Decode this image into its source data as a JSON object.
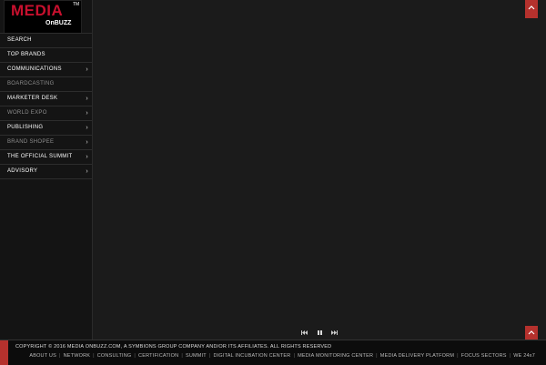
{
  "logo": {
    "line1": "MEDIA",
    "line2": "OnBUZZ",
    "tm": "TM"
  },
  "sidebar": {
    "items": [
      {
        "label": "SEARCH",
        "submenu": false
      },
      {
        "label": "TOP BRANDS",
        "submenu": false
      },
      {
        "label": "COMMUNICATIONS",
        "submenu": true
      },
      {
        "label": "BOARDCASTING",
        "submenu": false
      },
      {
        "label": "MARKETER DESK",
        "submenu": true
      },
      {
        "label": "WORLD EXPO",
        "submenu": true
      },
      {
        "label": "PUBLISHING",
        "submenu": true
      },
      {
        "label": "BRAND SHOPEE",
        "submenu": true
      },
      {
        "label": "THE OFFICIAL SUMMIT",
        "submenu": true
      },
      {
        "label": "ADVISORY",
        "submenu": true
      }
    ],
    "chevron": "›"
  },
  "footer": {
    "copyright": "COPYRIGHT © 2016 MEDIA ONBUZZ.COM, A SYMBIONS GROUP COMPANY AND/OR ITS AFFILIATES. ALL RIGHTS RESERVED",
    "links": [
      "ABOUT US",
      "NETWORK",
      "CONSULTING",
      "CERTIFICATION",
      "SUMMIT",
      "DIGITAL INCUBATION CENTER",
      "MEDIA MONITORING CENTER",
      "MEDIA DELIVERY PLATFORM",
      "FOCUS SECTORS",
      "WE 24x7"
    ]
  },
  "colors": {
    "accent": "#b5312d",
    "brand_red": "#c8102e",
    "background": "#1b1b1b"
  },
  "icons": {
    "scroll_top": "chevron-up-icon",
    "scroll_bottom": "chevron-up-icon",
    "prev": "skip-previous-icon",
    "pause": "pause-icon",
    "next": "skip-next-icon"
  }
}
